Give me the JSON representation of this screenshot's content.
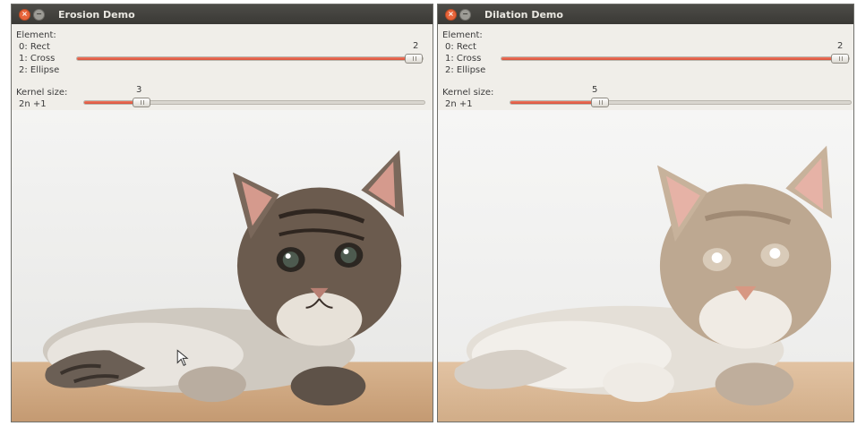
{
  "windows": [
    {
      "title": "Erosion Demo",
      "element_label": "Element:",
      "options": [
        "0: Rect",
        "1: Cross",
        "2: Ellipse"
      ],
      "element_value": "2",
      "element_fraction": 1.0,
      "kernel_label": "Kernel size:",
      "kernel_formula": "2n +1",
      "kernel_value": "3",
      "kernel_fraction": 0.15
    },
    {
      "title": "Dilation Demo",
      "element_label": "Element:",
      "options": [
        "0: Rect",
        "1: Cross",
        "2: Ellipse"
      ],
      "element_value": "2",
      "element_fraction": 1.0,
      "kernel_label": "Kernel size:",
      "kernel_formula": "2n +1",
      "kernel_value": "5",
      "kernel_fraction": 0.25
    }
  ],
  "colors": {
    "titlebar": "#3a3935",
    "slider_fill": "#d9513a",
    "window_bg": "#f0eee9"
  },
  "icons": {
    "close": "close-icon",
    "minimize": "minimize-icon"
  }
}
